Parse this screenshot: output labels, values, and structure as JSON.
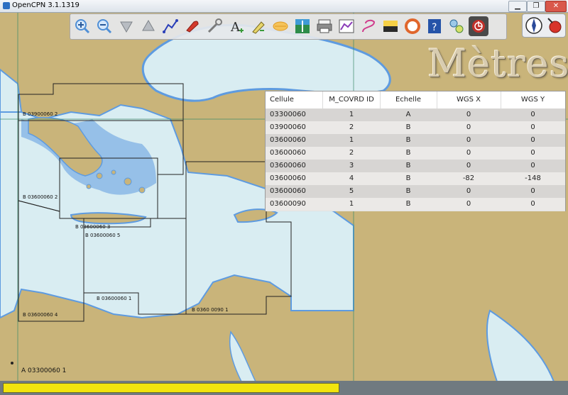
{
  "window": {
    "title": "OpenCPN 3.1.1319",
    "minimize": "▁",
    "restore": "❐",
    "close": "✕"
  },
  "toolbar": {
    "tools": [
      {
        "name": "zoom-in-icon",
        "color": "#4f8fd6"
      },
      {
        "name": "zoom-out-icon",
        "color": "#4f8fd6"
      },
      {
        "name": "scale-in-icon",
        "color": "#9aa0a6"
      },
      {
        "name": "scale-out-icon",
        "color": "#9aa0a6"
      },
      {
        "name": "route-icon",
        "color": "#2a3fb8"
      },
      {
        "name": "auto-follow-icon",
        "color": "#d33a2c"
      },
      {
        "name": "options-icon",
        "color": "#7b7b7b"
      },
      {
        "name": "text-icon",
        "color": "#2f2f2f"
      },
      {
        "name": "current-icon",
        "color": "#3b9b3b"
      },
      {
        "name": "tide-icon",
        "color": "#e09a20"
      },
      {
        "name": "chart-quilt-icon",
        "color": "#2d8c4a"
      },
      {
        "name": "print-icon",
        "color": "#555555"
      },
      {
        "name": "route-manager-icon",
        "color": "#8a3bb8"
      },
      {
        "name": "track-icon",
        "color": "#d03c8c"
      },
      {
        "name": "color-scheme-icon",
        "color": "#c8891a"
      },
      {
        "name": "mob-icon",
        "color": "#e0662c"
      },
      {
        "name": "help-icon",
        "color": "#2553a8"
      },
      {
        "name": "plugin-icon",
        "color": "#4a8a3a"
      },
      {
        "name": "dashboard-icon",
        "color": "#c0302a"
      }
    ]
  },
  "chart": {
    "units_label": "Mètres",
    "footer_label": "A 03300060 1",
    "cell_labels": [
      "B 03900060 2",
      "B 03600060 2",
      "B 03600060 3",
      "B 03600060 5",
      "B 03600060 1",
      "B 03600060 4",
      "B 0360 0090 1"
    ]
  },
  "cell_table": {
    "headers": [
      "Cellule",
      "M_COVRD ID",
      "Echelle",
      "WGS X",
      "WGS Y"
    ],
    "rows": [
      [
        "03300060",
        "1",
        "A",
        "0",
        "0"
      ],
      [
        "03900060",
        "2",
        "B",
        "0",
        "0"
      ],
      [
        "03600060",
        "1",
        "B",
        "0",
        "0"
      ],
      [
        "03600060",
        "2",
        "B",
        "0",
        "0"
      ],
      [
        "03600060",
        "3",
        "B",
        "0",
        "0"
      ],
      [
        "03600060",
        "4",
        "B",
        "-82",
        "-148"
      ],
      [
        "03600060",
        "5",
        "B",
        "0",
        "0"
      ],
      [
        "03600090",
        "1",
        "B",
        "0",
        "0"
      ]
    ]
  },
  "status": {
    "progress_fraction": 0.59,
    "progress_color": "#f2e40d"
  },
  "colors": {
    "land": "#c9b47a",
    "sea_shallow": "#5e9be0",
    "sea_deep": "#d9edf2",
    "cell_border": "#222222"
  }
}
